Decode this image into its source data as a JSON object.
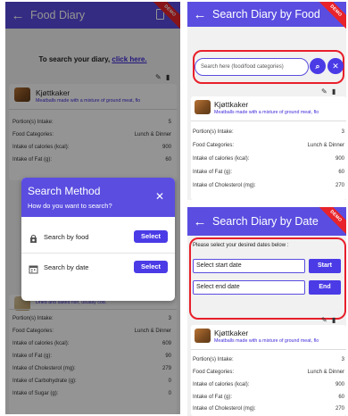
{
  "left": {
    "title": "Food Diary",
    "ribbon": "DEMO",
    "prompt_text": "To search your diary,",
    "prompt_link": "click here.",
    "card": {
      "name": "Kjøttkaker",
      "desc": "Meatballs made with a mixture of ground meat, flo",
      "rows": [
        {
          "label": "Portion(s) Intake:",
          "value": "5"
        },
        {
          "label": "Food Categories:",
          "value": "Lunch & Dinner"
        },
        {
          "label": "Intake of calories (kcal):",
          "value": "900"
        },
        {
          "label": "Intake of Fat (g):",
          "value": "60"
        }
      ]
    },
    "dialog": {
      "title": "Search Method",
      "subtitle": "How do you want to search?",
      "options": [
        {
          "label": "Search by food",
          "button": "Select"
        },
        {
          "label": "Search by date",
          "button": "Select"
        }
      ]
    },
    "card2": {
      "desc": "Dried and salted fish, usually cod.",
      "rows": [
        {
          "label": "Portion(s) Intake:",
          "value": "3"
        },
        {
          "label": "Food Categories:",
          "value": "Lunch & Dinner"
        },
        {
          "label": "Intake of calories (kcal):",
          "value": "609"
        },
        {
          "label": "Intake of Fat (g):",
          "value": "90"
        },
        {
          "label": "Intake of Cholesterol (mg):",
          "value": "279"
        },
        {
          "label": "Intake of Carbohydrate (g):",
          "value": "0"
        },
        {
          "label": "Intake of Sugar (g):",
          "value": "0"
        }
      ]
    }
  },
  "rtop": {
    "title": "Search Diary by Food",
    "ribbon": "DEMO",
    "search_placeholder": "Search here (food/food categories)",
    "card": {
      "name": "Kjøttkaker",
      "desc": "Meatballs made with a mixture of ground meat, flo",
      "rows": [
        {
          "label": "Portion(s) Intake:",
          "value": "3"
        },
        {
          "label": "Food Categories:",
          "value": "Lunch & Dinner"
        },
        {
          "label": "Intake of calories (kcal):",
          "value": "900"
        },
        {
          "label": "Intake of Fat (g):",
          "value": "60"
        },
        {
          "label": "Intake of Cholesterol (mg):",
          "value": "270"
        }
      ]
    }
  },
  "rbot": {
    "title": "Search Diary by Date",
    "ribbon": "DEMO",
    "hint": "Please select your desired dates below :",
    "start_field": "Select start date",
    "start_button": "Start",
    "end_field": "Select end date",
    "end_button": "End",
    "card": {
      "name": "Kjøttkaker",
      "desc": "Meatballs made with a mixture of ground meat, flo",
      "rows": [
        {
          "label": "Portion(s) Intake:",
          "value": "3"
        },
        {
          "label": "Food Categories:",
          "value": "Lunch & Dinner"
        },
        {
          "label": "Intake of calories (kcal):",
          "value": "900"
        },
        {
          "label": "Intake of Fat (g):",
          "value": "60"
        },
        {
          "label": "Intake of Cholesterol (mg):",
          "value": "270"
        }
      ]
    }
  }
}
